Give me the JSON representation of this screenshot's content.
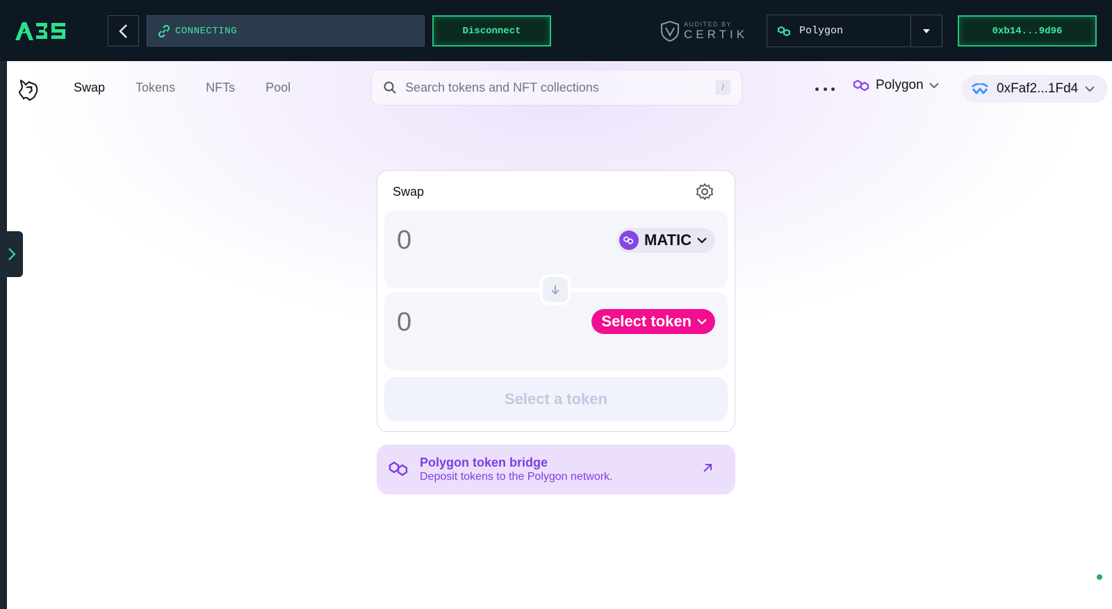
{
  "wallet_bar": {
    "logo_text": "A3S",
    "connection_status": "CONNECTING",
    "disconnect_label": "Disconnect",
    "audited_by": "AUDITED BY",
    "auditor": "CERTIK",
    "network": "Polygon",
    "address": "0xb14...9d96"
  },
  "nav": {
    "items": [
      "Swap",
      "Tokens",
      "NFTs",
      "Pool"
    ],
    "active": "Swap"
  },
  "search": {
    "placeholder": "Search tokens and NFT collections",
    "shortcut": "/"
  },
  "header_right": {
    "chain": "Polygon",
    "account": "0xFaf2...1Fd4"
  },
  "swap": {
    "title": "Swap",
    "input_amount": "0",
    "input_token": "MATIC",
    "output_amount": "0",
    "output_token_button": "Select token",
    "action_button": "Select a token"
  },
  "bridge": {
    "title": "Polygon token bridge",
    "subtitle": "Deposit tokens to the Polygon network."
  },
  "colors": {
    "accent_green": "#3ee8a3",
    "uniswap_pink": "#f20f8f",
    "polygon_purple": "#8247e5"
  },
  "icons": [
    "link-icon",
    "back-arrow-icon",
    "certik-shield-icon",
    "polygon-icon",
    "dropdown-caret-icon",
    "unicorn-logo-icon",
    "search-icon",
    "more-dots-icon",
    "walletconnect-icon",
    "chevron-down-icon",
    "gear-icon",
    "arrow-down-icon",
    "external-link-icon",
    "sidebar-expand-icon"
  ]
}
